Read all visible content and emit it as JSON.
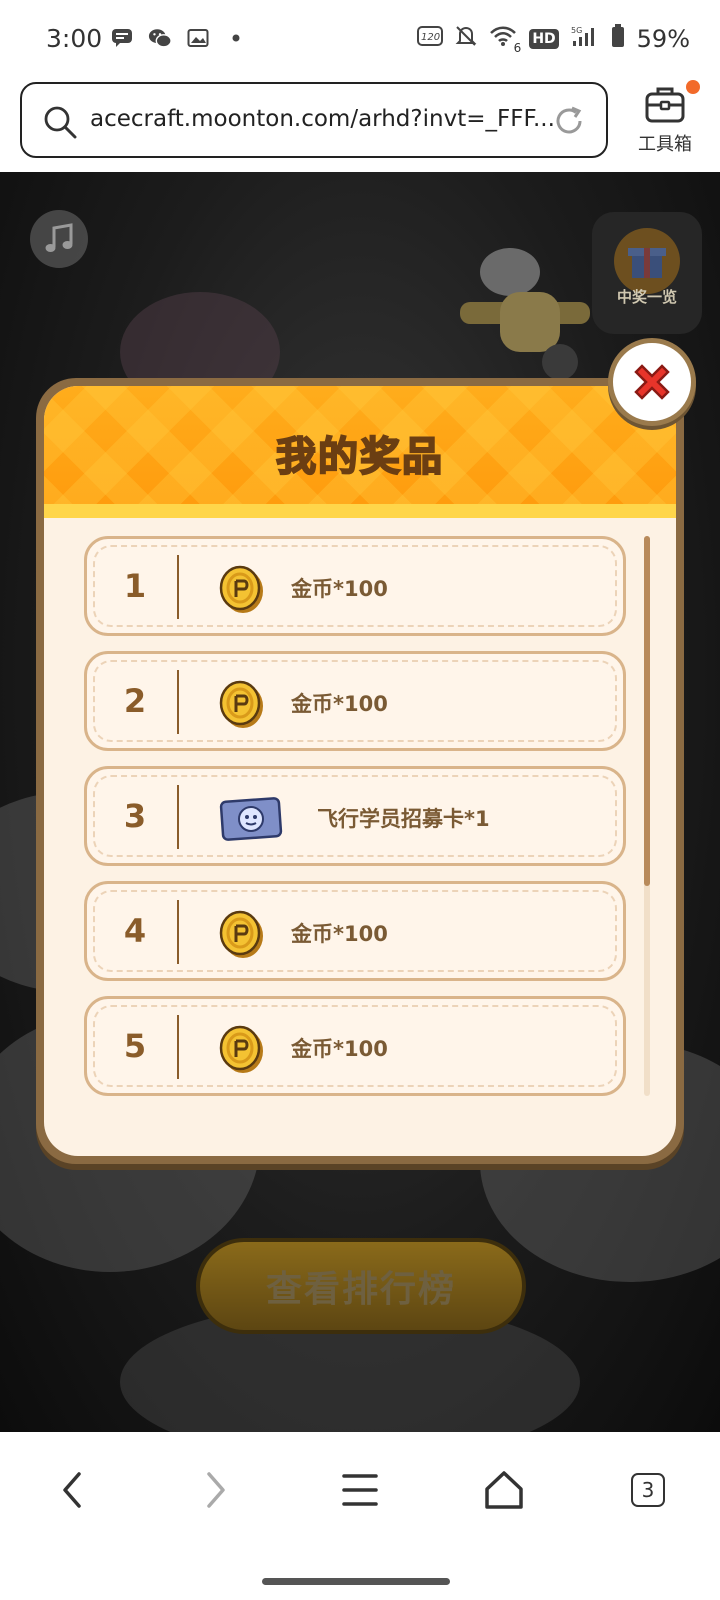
{
  "status_bar": {
    "time": "3:00",
    "left_icons": [
      "message-icon",
      "wechat-icon",
      "image-icon",
      "dot-icon"
    ],
    "right_icons": [
      "120hz-icon",
      "mute-icon",
      "wifi-icon",
      "hd-icon",
      "signal-icon",
      "battery-icon"
    ],
    "wifi_badge": "6",
    "hd_label": "HD",
    "battery": "59%"
  },
  "browser": {
    "url": "acecraft.moonton.com/arhd?invt=_FFF...",
    "toolbox_label": "工具箱"
  },
  "game": {
    "winners_label": "中奖一览",
    "leaderboard_button": "查看排行榜"
  },
  "modal": {
    "title": "我的奖品",
    "items": [
      {
        "rank": "1",
        "icon": "gold-coin-icon",
        "name": "金币*100"
      },
      {
        "rank": "2",
        "icon": "gold-coin-icon",
        "name": "金币*100"
      },
      {
        "rank": "3",
        "icon": "recruit-card-icon",
        "name": "飞行学员招募卡*1"
      },
      {
        "rank": "4",
        "icon": "gold-coin-icon",
        "name": "金币*100"
      },
      {
        "rank": "5",
        "icon": "gold-coin-icon",
        "name": "金币*100"
      }
    ]
  },
  "bottom_nav": {
    "tabs_count": "3"
  }
}
